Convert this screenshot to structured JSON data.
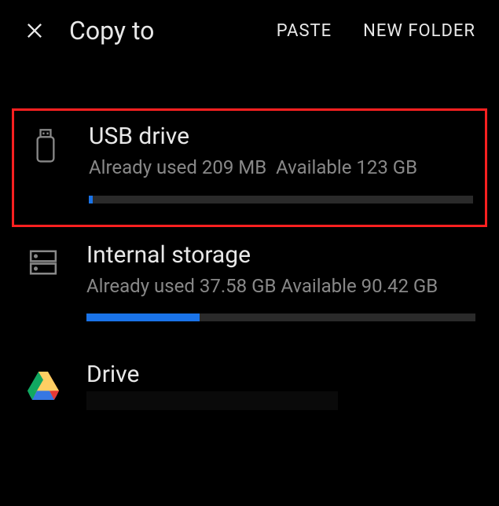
{
  "header": {
    "title": "Copy to",
    "paste_label": "PASTE",
    "new_folder_label": "NEW FOLDER"
  },
  "storage": [
    {
      "icon": "usb",
      "title": "USB drive",
      "used_text": "Already used 209 MB",
      "available_text": "Available 123 GB",
      "progress_percent": 1,
      "highlighted": true,
      "inline_info": true
    },
    {
      "icon": "internal",
      "title": "Internal storage",
      "used_text": "Already used 37.58 GB",
      "available_text": "Available 90.42 GB",
      "progress_percent": 29,
      "highlighted": false,
      "inline_info": false
    }
  ],
  "drive": {
    "title": "Drive"
  }
}
